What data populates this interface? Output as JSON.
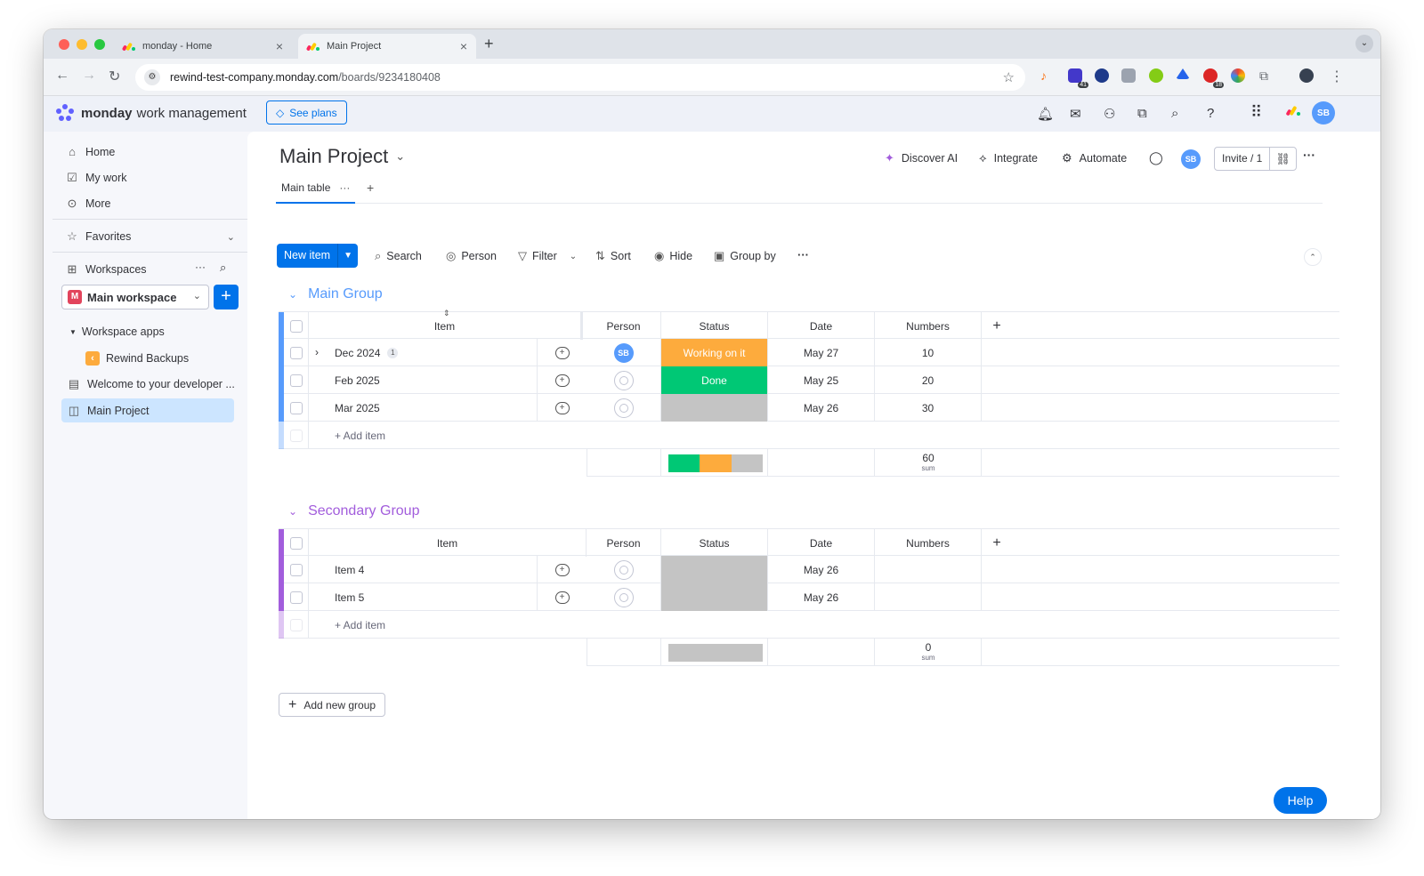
{
  "browser": {
    "tabs": [
      {
        "title": "monday - Home"
      },
      {
        "title": "Main Project"
      }
    ],
    "url_host": "rewind-test-company.monday.com",
    "url_path": "/boards/9234180408",
    "ext_badges": {
      "b41": "41",
      "b18": "18"
    }
  },
  "topbar": {
    "logo_bold": "monday",
    "logo_rest": "work management",
    "see_plans": "See plans",
    "avatar": "SB"
  },
  "sidebar": {
    "home": "Home",
    "my_work": "My work",
    "more": "More",
    "favorites": "Favorites",
    "workspaces": "Workspaces",
    "workspace_name": "Main workspace",
    "workspace_letter": "M",
    "workspace_apps": "Workspace apps",
    "rewind_backups": "Rewind Backups",
    "welcome_doc": "Welcome to your developer ...",
    "main_project": "Main Project"
  },
  "board": {
    "title": "Main Project",
    "view_tab": "Main table",
    "actions": {
      "discover_ai": "Discover AI",
      "integrate": "Integrate",
      "automate": "Automate",
      "avatar": "SB",
      "invite": "Invite / 1"
    },
    "toolbar": {
      "new_item": "New item",
      "search": "Search",
      "person": "Person",
      "filter": "Filter",
      "sort": "Sort",
      "hide": "Hide",
      "group_by": "Group by"
    },
    "columns": {
      "item": "Item",
      "person": "Person",
      "status": "Status",
      "date": "Date",
      "numbers": "Numbers"
    },
    "add_item": "+ Add item",
    "add_group": "Add new group",
    "help": "Help"
  },
  "groups": [
    {
      "name": "Main Group",
      "color": "#579bfc",
      "rows": [
        {
          "name": "Dec 2024",
          "subitems": "1",
          "person": "SB",
          "status": "Working on it",
          "status_color": "#fdab3d",
          "date": "May 27",
          "number": "10"
        },
        {
          "name": "Feb 2025",
          "person": "",
          "status": "Done",
          "status_color": "#00c875",
          "date": "May 25",
          "number": "20"
        },
        {
          "name": "Mar 2025",
          "person": "",
          "status": "",
          "status_color": "#c4c4c4",
          "date": "May 26",
          "number": "30"
        }
      ],
      "sum": "60",
      "sum_label": "sum"
    },
    {
      "name": "Secondary Group",
      "color": "#a25ddc",
      "rows": [
        {
          "name": "Item 4",
          "person": "",
          "status": "",
          "status_color": "#c4c4c4",
          "date": "May 26",
          "number": ""
        },
        {
          "name": "Item 5",
          "person": "",
          "status": "",
          "status_color": "#c4c4c4",
          "date": "May 26",
          "number": ""
        }
      ],
      "sum": "0",
      "sum_label": "sum"
    }
  ]
}
